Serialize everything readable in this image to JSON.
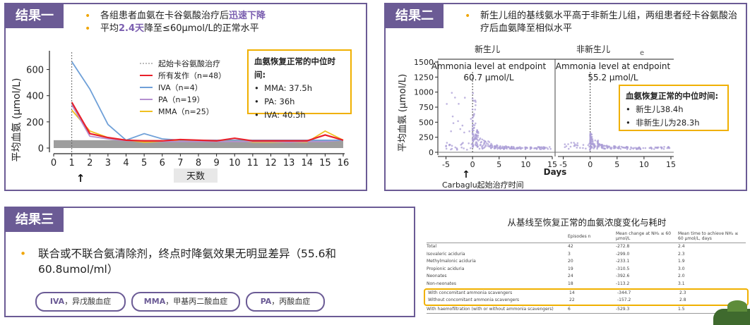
{
  "panel1": {
    "title": "结果一",
    "bullet1_a": "各组患者血氨在卡谷氨酸治疗后",
    "bullet1_hl": "迅速下降",
    "bullet2_a": "平均",
    "bullet2_hl": "2.4天",
    "bullet2_b": "降至≤60μmol/L的正常水平",
    "info_title": "血氨恢复正常的中位时间:",
    "info_items": [
      "MMA: 37.5h",
      "PA: 36h",
      "IVA: 40.5h"
    ]
  },
  "panel2": {
    "title": "结果二",
    "bullet1": "新生儿组的基线氨水平高于非新生儿组，两组患者经卡谷氨酸治疗后血氨降至相似水平",
    "label_left": "新生儿",
    "label_right": "非新生儿",
    "small_mark": "e",
    "left_text1": "Ammonia level at endpoint",
    "left_text2": "60.7 μmol/L",
    "right_text1": "Ammonia level at endpoint",
    "right_text2": "55.2 μmol/L",
    "info_title": "血氨恢复正常的中位时间:",
    "info_items": [
      "新生儿38.4h",
      "非新生儿为28.3h"
    ],
    "footnote": "Carbaglu起始治疗时间"
  },
  "panel3": {
    "title": "结果三",
    "bullet": "联合或不联合氨清除剂，终点时降氨效果无明显差异（55.6和60.8umol/ml）",
    "tags": [
      {
        "abbr": "IVA",
        "desc": "，异戊酸血症"
      },
      {
        "abbr": "MMA",
        "desc": "，甲基丙二酸血症"
      },
      {
        "abbr": "PA",
        "desc": "，丙酸血症"
      }
    ],
    "table_title": "从基线至恢复正常的血氨浓度变化与耗时",
    "table_headers": [
      "",
      "Episodes n",
      "Mean change at NH₃ ≤ 60 μmol/L",
      "Mean time to achieve NH₃ ≤ 60 μmol/L, days"
    ],
    "table_rows": [
      [
        "Total",
        "42",
        "-272.8",
        "2.4"
      ],
      [
        "Isovaleric aciduria",
        "3",
        "-299.0",
        "2.3"
      ],
      [
        "Methylmalonic aciduria",
        "20",
        "-233.1",
        "1.9"
      ],
      [
        "Propionic aciduria",
        "19",
        "-310.5",
        "3.0"
      ],
      [
        "Neonates",
        "24",
        "-392.6",
        "2.0"
      ],
      [
        "Non-neonates",
        "18",
        "-113.2",
        "3.1"
      ],
      [
        "With concomitant ammonia scavengers",
        "14",
        "-344.7",
        "2.3"
      ],
      [
        "Without concomitant ammonia scavengers",
        "22",
        "-157.2",
        "2.8"
      ],
      [
        "With haemofiltration (with or without ammonia scavengers)",
        "6",
        "-529.3",
        "1.5"
      ]
    ]
  },
  "chart_data": [
    {
      "type": "line",
      "ylabel": "平均血氨 (μmol/L)",
      "xlabel": "天数",
      "x": [
        0,
        1,
        2,
        3,
        4,
        5,
        6,
        7,
        8,
        9,
        10,
        11,
        12,
        13,
        14,
        15,
        16
      ],
      "ylim": [
        0,
        700
      ],
      "xlim": [
        0,
        16
      ],
      "yticks": [
        0,
        200,
        400,
        600
      ],
      "marker_label": "起始卡谷氨酸治疗",
      "marker_x": 1,
      "normal_band": [
        0,
        60
      ],
      "series": [
        {
          "name": "所有发作（n=48）",
          "color": "#e8202a",
          "x": [
            1,
            2,
            3,
            4,
            5,
            6,
            7,
            8,
            9,
            10,
            11,
            12,
            13,
            14,
            15,
            16
          ],
          "values": [
            350,
            110,
            80,
            60,
            55,
            55,
            65,
            60,
            55,
            75,
            55,
            55,
            55,
            55,
            100,
            60
          ]
        },
        {
          "name": "IVA（n=4）",
          "color": "#6fa0d8",
          "x": [
            1,
            2,
            3,
            4,
            5,
            6,
            7,
            8,
            9,
            10,
            11,
            12,
            13,
            14,
            15,
            16
          ],
          "values": [
            660,
            450,
            180,
            60,
            110,
            70,
            60,
            60,
            60,
            60,
            60,
            60,
            60,
            60,
            60,
            60
          ]
        },
        {
          "name": "PA（n=19）",
          "color": "#b48fd0",
          "x": [
            1,
            2,
            3,
            4,
            5,
            6,
            7,
            8,
            9,
            10,
            11,
            12,
            13,
            14,
            15,
            16
          ],
          "values": [
            330,
            90,
            70,
            55,
            55,
            50,
            50,
            50,
            50,
            50,
            50,
            50,
            45,
            50,
            50,
            60
          ]
        },
        {
          "name": "MMA（n=25）",
          "color": "#f0c020",
          "x": [
            1,
            2,
            3,
            4,
            5,
            6,
            7,
            8,
            9,
            10,
            11,
            12,
            13,
            14,
            15,
            16
          ],
          "values": [
            290,
            130,
            80,
            60,
            45,
            50,
            55,
            55,
            50,
            60,
            45,
            45,
            45,
            45,
            130,
            60
          ]
        }
      ]
    },
    {
      "type": "scatter",
      "ylabel": "平均血氨 (μmol/L)",
      "xlabel": "Days",
      "ylim": [
        0,
        1500
      ],
      "yticks": [
        0,
        250,
        500,
        750,
        1000,
        1250,
        1500
      ],
      "xticks_left": [
        -5,
        0,
        5,
        10,
        15
      ],
      "xticks_right": [
        -5,
        0,
        5,
        10,
        15
      ]
    }
  ]
}
